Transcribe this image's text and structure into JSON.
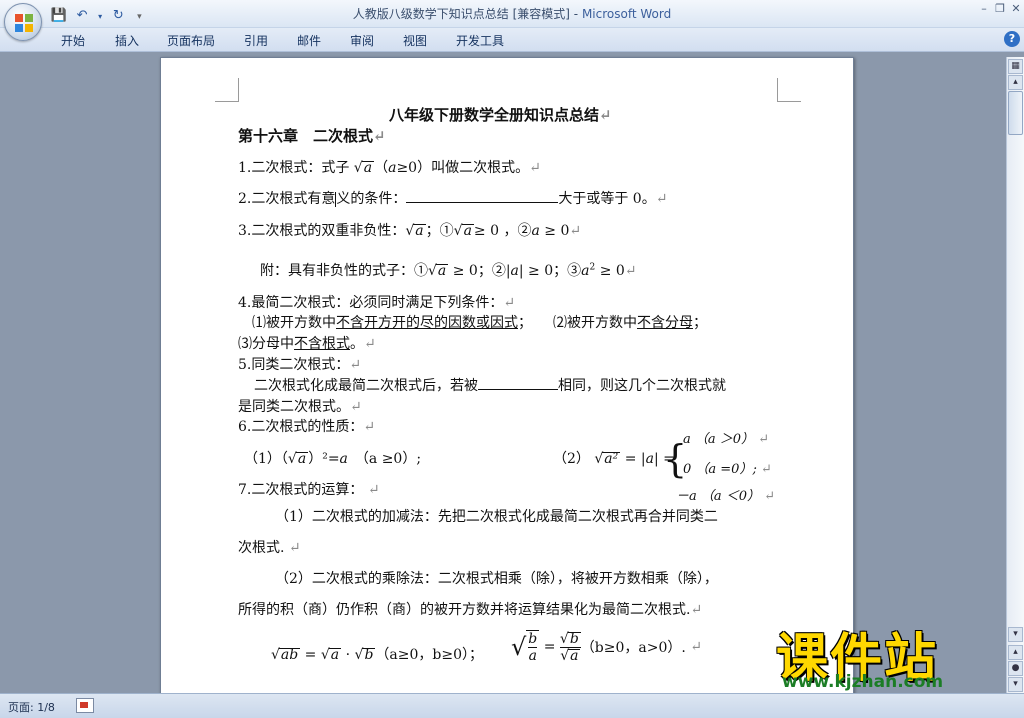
{
  "window": {
    "title_doc": "人教版八级数学下知识点总结 [兼容模式]",
    "title_sep": " - ",
    "title_app": "Microsoft Word"
  },
  "ribbon": {
    "tabs": [
      "开始",
      "插入",
      "页面布局",
      "引用",
      "邮件",
      "审阅",
      "视图",
      "开发工具"
    ]
  },
  "doc": {
    "title": "八年级下册数学全册知识点总结",
    "chapter": "第十六章　二次根式",
    "l1_a": "1.二次根式：式子",
    "l1_rad": "a",
    "l1_b": "（",
    "l1_cond": "a",
    "l1_c": "≥0）叫做二次根式。",
    "l2_a": "2.二次根式有意",
    "l2_b": "义的条件：",
    "l2_c": "大于或等于 0。",
    "l3_a": "3.二次根式的双重非负性：",
    "l3_rad1": "a",
    "l3_b": "；①",
    "l3_rad2": "a",
    "l3_c": "≥ 0 ，②",
    "l3_var": "a",
    "l3_d": " ≥ 0",
    "l4_a": "附：具有非负性的式子：①",
    "l4_rad": "a",
    "l4_b": " ≥ 0；②",
    "l4_abs": "|a|",
    "l4_c": " ≥ 0；③",
    "l4_var": "a",
    "l4_sup": "2",
    "l4_d": " ≥ 0",
    "l5": "4.最简二次根式：必须同时满足下列条件：",
    "l6_a": "⑴被开方数中",
    "l6_u1": "不含开方开的尽的因数或因式",
    "l6_b": "；　　⑵被开方数中",
    "l6_u2": "不含分母",
    "l6_c": "；",
    "l7_a": "⑶分母中",
    "l7_u": "不含根式",
    "l7_b": "。",
    "l8": "5.同类二次根式：",
    "l9_a": "二次根式化成最简二次根式后，若被",
    "l9_b": "相同，则这几个二次根式就",
    "l10": "是同类二次根式。",
    "l11": "6.二次根式的性质：",
    "l12_a": "（1）（",
    "l12_rad": "a",
    "l12_b": "）²=",
    "l12_var": "a",
    "l12_c": "　（a ≥0）;",
    "l12_d": "（2）",
    "l12_rad2": "a²",
    "l12_e": " = |a| =",
    "case1": "a （a ＞0）",
    "case2": "0 （a =0）;",
    "case3": "－a （a ＜0）",
    "l13": "7.二次根式的运算：",
    "l14": "（1）二次根式的加减法：先把二次根式化成最简二次根式再合并同类二",
    "l15": "次根式.",
    "l16": "（2）二次根式的乘除法：二次根式相乘（除），将被开方数相乘（除），",
    "l17": "所得的积（商）仍作积（商）的被开方数并将运算结果化为最简二次根式.",
    "l18_rad1": "ab",
    "l18_a": " = ",
    "l18_rad2": "a",
    "l18_b": " · ",
    "l18_rad3": "b",
    "l18_c": "（a≥0，b≥0）；",
    "l18_frac_num": "b",
    "l18_frac_den": "a",
    "l18_d": " = ",
    "l18_num2": "b",
    "l18_den2": "a",
    "l18_e": "（b≥0，a>0）.",
    "para_mark": "↵"
  },
  "status": {
    "page": "页面: 1/8"
  },
  "watermark": {
    "main": "课件站",
    "url": "www.kjzhan.com"
  }
}
